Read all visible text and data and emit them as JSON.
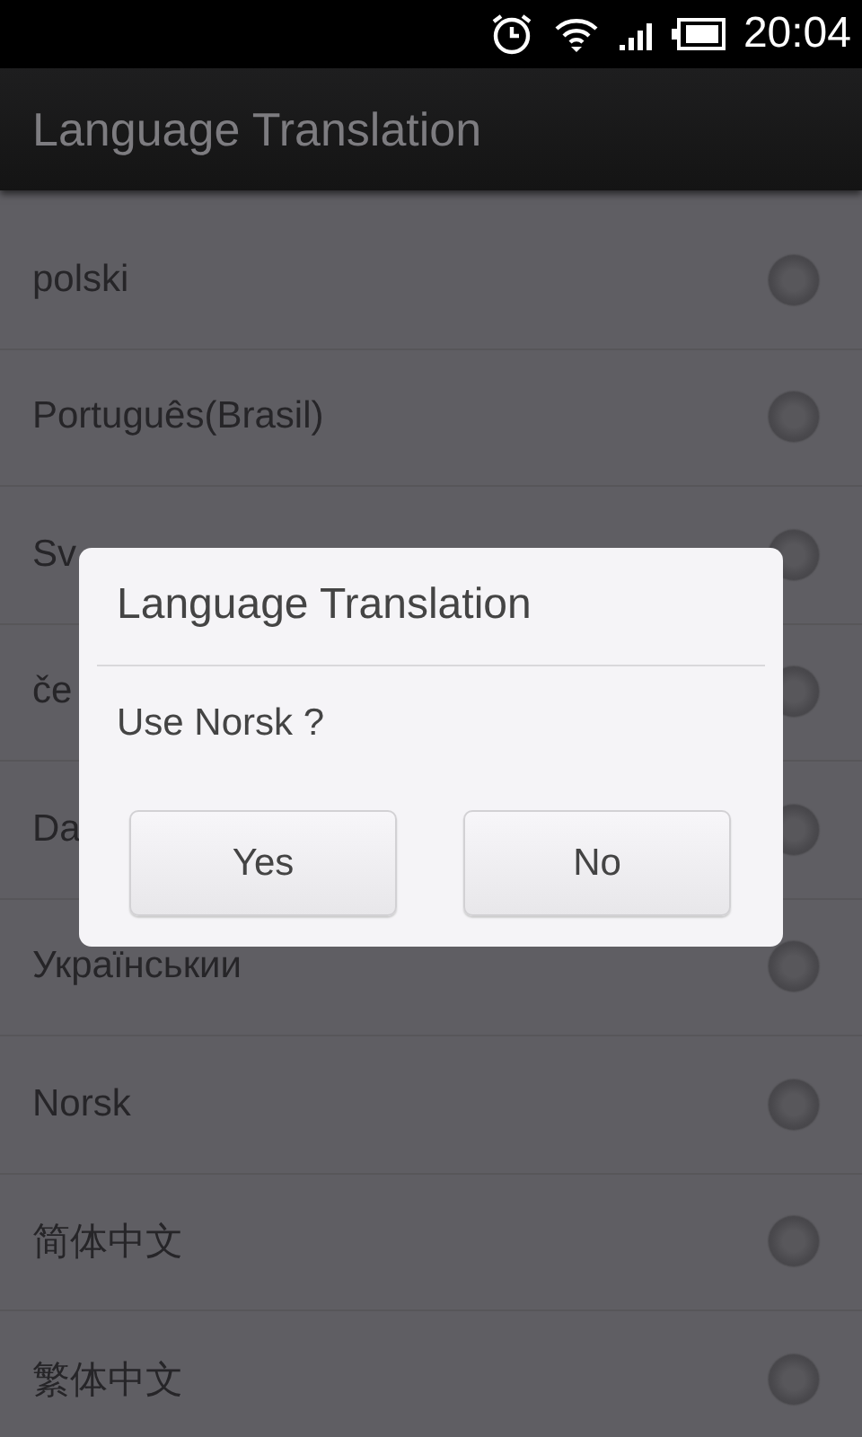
{
  "status_bar": {
    "time": "20:04"
  },
  "app_bar": {
    "title": "Language Translation"
  },
  "languages": [
    {
      "label": "polski",
      "selected": false
    },
    {
      "label": "Português(Brasil)",
      "selected": false
    },
    {
      "label": "Sv",
      "selected": false
    },
    {
      "label": "če",
      "selected": false
    },
    {
      "label": "Da",
      "selected": false
    },
    {
      "label": "Українськии",
      "selected": false
    },
    {
      "label": "Norsk",
      "selected": false
    },
    {
      "label": "简体中文",
      "selected": false
    },
    {
      "label": "繁体中文",
      "selected": false
    }
  ],
  "dialog": {
    "title": "Language Translation",
    "message": "Use Norsk ?",
    "buttons": [
      "Yes",
      "No"
    ]
  }
}
